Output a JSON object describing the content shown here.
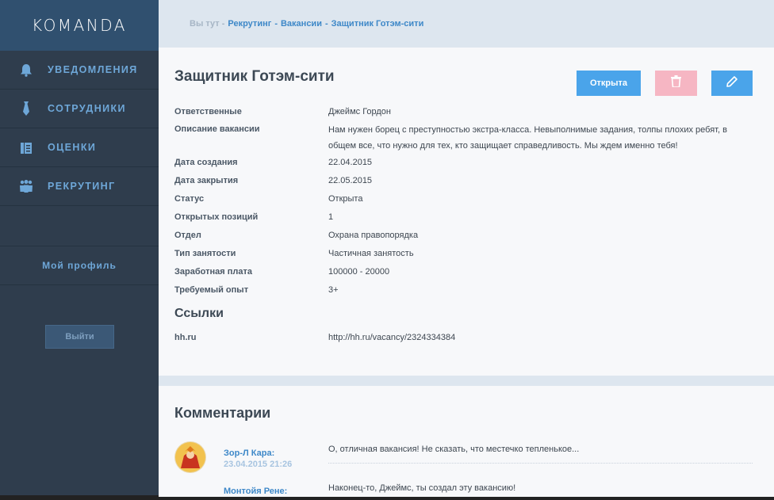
{
  "brand": {
    "logo": "KOMANDA"
  },
  "sidebar": {
    "items": [
      {
        "label": "УВЕДОМЛЕНИЯ",
        "icon": "bell-icon"
      },
      {
        "label": "СОТРУДНИКИ",
        "icon": "tie-icon"
      },
      {
        "label": "ОЦЕНКИ",
        "icon": "clipboard-icon"
      },
      {
        "label": "РЕКРУТИНГ",
        "icon": "people-icon"
      }
    ],
    "profile": "Мой профиль",
    "logout": "Выйти"
  },
  "breadcrumb": {
    "prefix": "Вы тут -",
    "items": [
      "Рекрутинг",
      "Вакансии",
      "Защитник Готэм-сити"
    ],
    "sep": "-"
  },
  "vacancy": {
    "title": "Защитник Готэм-сити",
    "status_button": "Открыта",
    "colors": {
      "primary": "#4aa4ea",
      "danger": "#f6b6c3"
    },
    "fields": [
      {
        "label": "Ответственные",
        "value": "Джеймс Гордон"
      },
      {
        "label": "Описание вакансии",
        "value": "Нам нужен борец с преступностью экстра-класса. Невыполнимые задания, толпы плохих ребят, в общем все, что нужно для тех, кто защищает справедливость. Мы ждем именно тебя!"
      },
      {
        "label": "Дата создания",
        "value": "22.04.2015"
      },
      {
        "label": "Дата закрытия",
        "value": "22.05.2015"
      },
      {
        "label": "Статус",
        "value": "Открыта"
      },
      {
        "label": "Открытых позиций",
        "value": "1"
      },
      {
        "label": "Отдел",
        "value": "Охрана правопорядка"
      },
      {
        "label": "Тип занятости",
        "value": "Частичная занятость"
      },
      {
        "label": "Заработная плата",
        "value": "100000 - 20000"
      },
      {
        "label": "Требуемый опыт",
        "value": "3+"
      }
    ],
    "links_title": "Ссылки",
    "links": [
      {
        "label": "hh.ru",
        "url": "http://hh.ru/vacancy/2324334384"
      }
    ]
  },
  "comments": {
    "title": "Комментарии",
    "items": [
      {
        "author": "Зор-Л Кара:",
        "date": "23.04.2015 21:26",
        "text": "О, отличная вакансия! Не сказать, что местечко тепленькое..."
      },
      {
        "author": "Монтойя Рене:",
        "text": "Наконец-то, Джеймс, ты создал эту вакансию!"
      }
    ]
  }
}
